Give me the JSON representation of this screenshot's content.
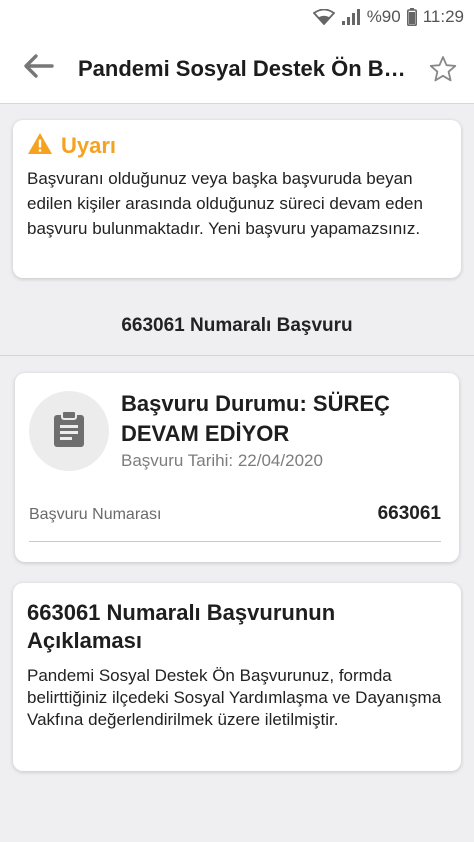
{
  "status_bar": {
    "battery": "%90",
    "time": "11:29"
  },
  "app_bar": {
    "title": "Pandemi Sosyal Destek Ön Başvuru"
  },
  "warning": {
    "title": "Uyarı",
    "message": "Başvuranı olduğunuz veya başka başvuruda beyan edilen kişiler arasında olduğunuz süreci devam eden başvuru bulunmaktadır. Yeni başvuru yapamazsınız.",
    "color": "#f4a21f"
  },
  "section": {
    "heading": "663061 Numaralı Başvuru"
  },
  "status_card": {
    "status_title": "Başvuru Durumu: SÜREÇ DEVAM EDİYOR",
    "date_text": "Başvuru Tarihi: 22/04/2020",
    "number_label": "Başvuru Numarası",
    "number_value": "663061",
    "icon": "document-icon"
  },
  "description_card": {
    "title": "663061 Numaralı Başvurunun Açıklaması",
    "text": "Pandemi Sosyal Destek Ön Başvurunuz, formda belirttiğiniz ilçedeki Sosyal Yardımlaşma ve Dayanışma Vakfına değerlendirilmek üzere iletilmiştir."
  }
}
